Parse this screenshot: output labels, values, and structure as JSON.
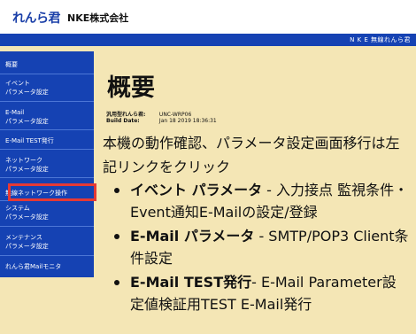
{
  "header": {
    "logo_text": "れんら君",
    "company": "NKE株式会社",
    "banner_text": "N K E 無線れんら君"
  },
  "sidebar": {
    "items": [
      {
        "lines": [
          "概要"
        ]
      },
      {
        "lines": [
          "イベント",
          "パラメータ設定"
        ]
      },
      {
        "lines": [
          "E-Mail",
          "パラメータ設定"
        ]
      },
      {
        "lines": [
          "E-Mail TEST発行"
        ]
      },
      {
        "lines": [
          "ネットワーク",
          "パラメータ設定"
        ]
      },
      {
        "lines": [
          "無線ネットワーク操作"
        ]
      },
      {
        "lines": [
          "システム",
          "パラメータ設定"
        ]
      },
      {
        "lines": [
          "メンテナンス",
          "パラメータ設定"
        ]
      },
      {
        "lines": [
          "れんら君Mailモニタ"
        ]
      }
    ]
  },
  "main": {
    "title": "概要",
    "model_label": "汎用型れんら君:",
    "model_value": "UNC-WRP06",
    "build_label": "Build Date:",
    "build_value": "Jan 18 2019 18:36:31",
    "intro": "本機の動作確認、パラメータ設定画面移行は左記リンクをクリック",
    "bullets": [
      {
        "bold": "イベント パラメータ",
        "rest": " - 入力接点 監視条件・Event通知E-Mailの設定/登録"
      },
      {
        "bold": "E-Mail パラメータ",
        "rest": " - SMTP/POP3 Client条件設定"
      },
      {
        "bold": "E-Mail TEST発行",
        "rest": "- E-Mail Parameter設定値検証用TEST E-Mail発行"
      }
    ]
  },
  "colors": {
    "sidebar_blue": "#1542b3",
    "page_background": "#f4e6b5",
    "highlight_red": "#e53935"
  }
}
